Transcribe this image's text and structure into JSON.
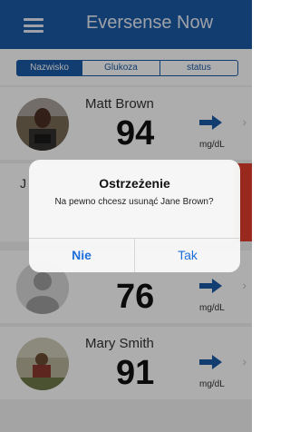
{
  "header": {
    "title": "Eversense Now"
  },
  "tabs": [
    {
      "label": "Nazwisko",
      "active": true
    },
    {
      "label": "Glukoza",
      "active": false
    },
    {
      "label": "status",
      "active": false
    }
  ],
  "rows": [
    {
      "name": "Matt Brown",
      "glucose": "94",
      "unit": "mg/dL",
      "trend": "right-arrow-icon"
    },
    {
      "name": "J",
      "glucose": "",
      "unit": "",
      "trend": ""
    },
    {
      "name": "",
      "glucose": "76",
      "unit": "mg/dL",
      "trend": "right-arrow-icon"
    },
    {
      "name": "Mary Smith",
      "glucose": "91",
      "unit": "mg/dL",
      "trend": "right-arrow-icon"
    }
  ],
  "dialog": {
    "title": "Ostrzeżenie",
    "message": "Na pewno chcesz usunąć  Jane Brown?",
    "no_label": "Nie",
    "yes_label": "Tak"
  },
  "colors": {
    "brand": "#1b5aa6",
    "delete": "#e23c2e",
    "dialog_button": "#1e6fd9"
  }
}
